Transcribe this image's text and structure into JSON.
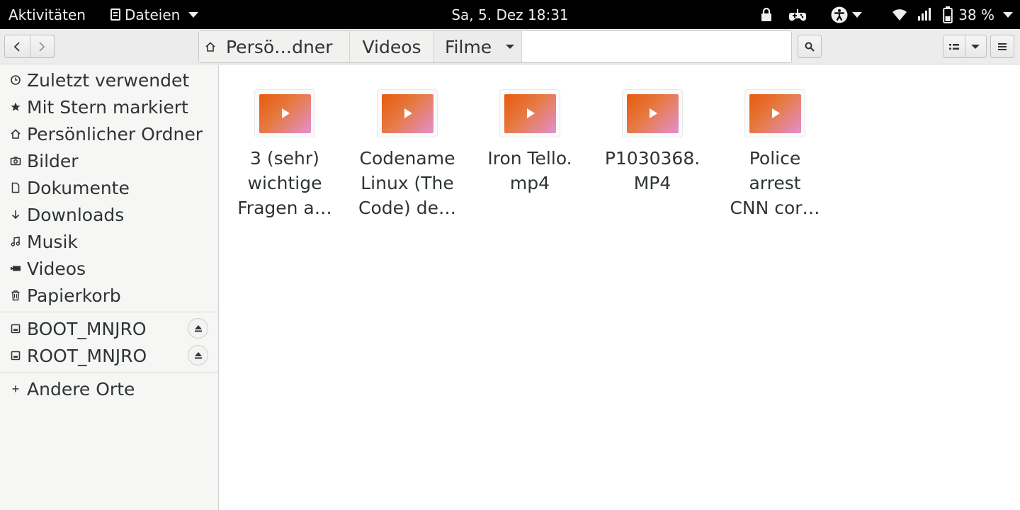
{
  "topbar": {
    "activities": "Aktivitäten",
    "app_menu": "Dateien",
    "clock": "Sa,  5. Dez  18:31",
    "battery": "38 %"
  },
  "pathbar": {
    "home": "Persö…dner",
    "videos": "Videos",
    "current": "Filme"
  },
  "sidebar": {
    "places": [
      {
        "label": "Zuletzt verwendet",
        "icon": "clock-icon"
      },
      {
        "label": "Mit Stern markiert",
        "icon": "star-icon"
      },
      {
        "label": "Persönlicher Ordner",
        "icon": "home-icon"
      },
      {
        "label": "Bilder",
        "icon": "camera-icon"
      },
      {
        "label": "Dokumente",
        "icon": "document-icon"
      },
      {
        "label": "Downloads",
        "icon": "download-arrow-icon"
      },
      {
        "label": "Musik",
        "icon": "music-note-icon"
      },
      {
        "label": "Videos",
        "icon": "video-camera-icon"
      },
      {
        "label": "Papierkorb",
        "icon": "trash-icon"
      }
    ],
    "devices": [
      {
        "label": "BOOT_MNJRO",
        "icon": "drive-icon"
      },
      {
        "label": "ROOT_MNJRO",
        "icon": "drive-icon"
      }
    ],
    "other": {
      "label": "Andere Orte",
      "icon": "plus-icon"
    }
  },
  "files": [
    {
      "line1": "3 (sehr)",
      "line2": "wichtige",
      "line3": "Fragen a…"
    },
    {
      "line1": "Codename",
      "line2": "Linux (The",
      "line3": "Code) de…"
    },
    {
      "line1": "Iron Tello.",
      "line2": "mp4",
      "line3": ""
    },
    {
      "line1": "P1030368.",
      "line2": "MP4",
      "line3": ""
    },
    {
      "line1": "Police",
      "line2": "arrest",
      "line3": "CNN cor…"
    }
  ],
  "colors": {
    "topbar_bg": "#000000",
    "video_thumb_start": "#e8590c",
    "video_thumb_end": "#e38fd0"
  }
}
